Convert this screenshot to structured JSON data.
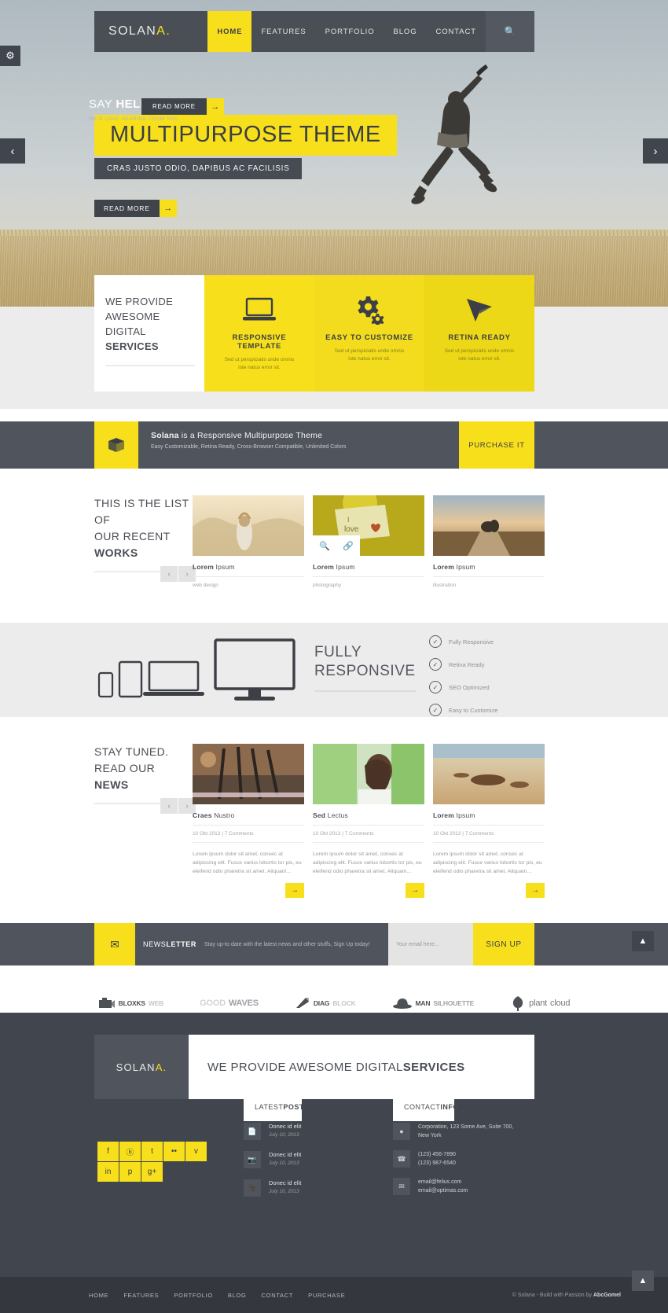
{
  "header": {
    "logo": "SOLAN",
    "logo_accent": "A.",
    "nav": [
      {
        "label": "HOME",
        "active": true
      },
      {
        "label": "FEATURES",
        "active": false
      },
      {
        "label": "PORTFOLIO",
        "active": false
      },
      {
        "label": "BLOG",
        "active": false
      },
      {
        "label": "CONTACT",
        "active": false
      }
    ],
    "search_icon": "search-icon"
  },
  "hero": {
    "title": "MULTIPURPOSE THEME",
    "subtitle": "CRAS JUSTO ODIO, DAPIBUS AC FACILISIS",
    "button": "READ MORE",
    "button_arrow": "→",
    "prev_arrow": "‹",
    "next_arrow": "›",
    "settings_icon": "gear-icon"
  },
  "services": {
    "intro_line1": "WE PROVIDE",
    "intro_line2": "AWESOME DIGITAL",
    "intro_line3": "SERVICES",
    "read_more": "READ MORE",
    "read_more_arrow": "→",
    "cards": [
      {
        "icon": "laptop-icon",
        "title": "RESPONSIVE TEMPLATE",
        "text": "Sed ut perspiciatis unde omnis iste natus error sit."
      },
      {
        "icon": "gears-icon",
        "title": "EASY TO CUSTOMIZE",
        "text": "Sed ut perspiciatis unde omnis iste natus error sit."
      },
      {
        "icon": "cursor-icon",
        "title": "RETINA READY",
        "text": "Sed ut perspiciatis unde omnis iste natus error sit."
      }
    ]
  },
  "banner": {
    "icon": "box-icon",
    "title_strong": "Solana",
    "title_rest": " is a Responsive Multipurpose Theme",
    "subtitle": "Easy Customizable, Retina Ready, Cross-Browser Compatible, Unlimited Colors",
    "cta": "PURCHASE IT"
  },
  "portfolio": {
    "heading_line1": "THIS IS THE LIST OF",
    "heading_line2": "OUR RECENT",
    "heading_line3": "WORKS",
    "prev": "‹",
    "next": "›",
    "hover_icons": [
      "search-icon",
      "link-icon"
    ],
    "items": [
      {
        "title_strong": "Lorem",
        "title_rest": " Ipsum",
        "meta": "web design"
      },
      {
        "title_strong": "Lorem",
        "title_rest": " Ipsum",
        "meta": "photography"
      },
      {
        "title_strong": "Lorem",
        "title_rest": " Ipsum",
        "meta": "illustration"
      }
    ]
  },
  "responsive": {
    "title_line1": "FULLY",
    "title_line2": "RESPONSIVE",
    "features": [
      {
        "label": "Fully Responsive",
        "icon": "check-circle-icon"
      },
      {
        "label": "Retina Ready",
        "icon": "check-circle-icon"
      },
      {
        "label": "SEO Optimized",
        "icon": "check-circle-icon"
      },
      {
        "label": "Easy to Customize",
        "icon": "check-circle-icon"
      }
    ]
  },
  "news": {
    "heading_line1": "STAY TUNED.",
    "heading_line2": "READ OUR",
    "heading_line3": "NEWS",
    "prev": "‹",
    "next": "›",
    "more_arrow": "→",
    "items": [
      {
        "title_strong": "Craes",
        "title_rest": " Nustro",
        "meta": "10 Okt 2013 | 7 Comments",
        "excerpt": "Lorem ipsum dolor sit amet, consec at adipiscing elit. Fusce varius lobortis tor pis, eu eleifend odio pharetra sit amet. Aliquam..."
      },
      {
        "title_strong": "Sed",
        "title_rest": " Lectus",
        "meta": "10 Okt 2013 | 7 Comments",
        "excerpt": "Lorem ipsum dolor sit amet, consec at adipiscing elit. Fusce varius lobortis tor pis, eu eleifend odio pharetra sit amet. Aliquam..."
      },
      {
        "title_strong": "Lorem",
        "title_rest": " Ipsum",
        "meta": "10 Okt 2013 | 7 Comments",
        "excerpt": "Lorem ipsum dolor sit amet, consec at adipiscing elit. Fusce varius lobortis tor pis, eu eleifend odio pharetra sit amet. Aliquam..."
      }
    ]
  },
  "newsletter": {
    "icon": "envelope-icon",
    "label_first": "NEWS ",
    "label_second": "LETTER",
    "description": "Stay up-to date with the latest news and other stuffs, Sign Up today!",
    "input_placeholder": "Your email here...",
    "button": "SIGN UP",
    "to_top_icon": "chevron-up-icon"
  },
  "clients": [
    {
      "name": "BLOXKS",
      "suffix": "WEB",
      "icon": "camera-logo-icon"
    },
    {
      "name": "GOOD",
      "suffix": "WAVES",
      "icon": "wave-logo-icon"
    },
    {
      "name": "DIAG",
      "suffix": "BLOCK",
      "icon": "diagonal-logo-icon"
    },
    {
      "name": "MAN",
      "suffix": "SILHOUETTE",
      "icon": "hat-logo-icon"
    },
    {
      "name": "plant",
      "suffix": "cloud",
      "icon": "tree-logo-icon"
    }
  ],
  "footer": {
    "logo": "SOLAN",
    "logo_accent": "A.",
    "claim_light": "WE PROVIDE AWESOME DIGITAL ",
    "claim_bold": "SERVICES",
    "say_hello_light": "SAY ",
    "say_hello_bold": "HELLO",
    "say_hello_sub": "WE'D LOVE HEARING FROM YOU",
    "social": [
      {
        "icon": "facebook-icon",
        "glyph": "f"
      },
      {
        "icon": "dribbble-icon",
        "glyph": "ⓑ"
      },
      {
        "icon": "twitter-icon",
        "glyph": "t"
      },
      {
        "icon": "flickr-icon",
        "glyph": "••"
      },
      {
        "icon": "vimeo-icon",
        "glyph": "v"
      },
      {
        "icon": "linkedin-icon",
        "glyph": "in"
      },
      {
        "icon": "pinterest-icon",
        "glyph": "p"
      },
      {
        "icon": "googleplus-icon",
        "glyph": "g+"
      }
    ],
    "latest_post_head_light": "LATEST ",
    "latest_post_head_bold": "POST",
    "posts": [
      {
        "icon": "file-icon",
        "title": "Donec id elit",
        "date": "July 10, 2013"
      },
      {
        "icon": "image-icon",
        "title": "Donec id elit",
        "date": "July 10, 2013"
      },
      {
        "icon": "video-icon",
        "title": "Donec id elit",
        "date": "July 10, 2013"
      }
    ],
    "contact_head_light": "CONTACT ",
    "contact_head_bold": "INFO",
    "contacts": [
      {
        "icon": "map-pin-icon",
        "line1": "Corporation, 123 Some Ave, Suite 700,",
        "line2": "New York"
      },
      {
        "icon": "phone-icon",
        "line1": "(123) 456-7890",
        "line2": "(123) 987-6540"
      },
      {
        "icon": "mail-icon",
        "line1": "email@felius.com",
        "line2": "email@optimas.com"
      }
    ],
    "bottom_nav": [
      "HOME",
      "FEATURES",
      "PORTFOLIO",
      "BLOG",
      "CONTACT",
      "PURCHASE"
    ],
    "copyright_pre": "© Solana - Build with Passion by ",
    "copyright_brand": "AbcGomel",
    "to_top_icon": "chevron-up-icon"
  },
  "colors": {
    "accent": "#f7e01b",
    "dark": "#41454d",
    "muted_dark": "#50545c",
    "light_gray": "#ececec"
  }
}
